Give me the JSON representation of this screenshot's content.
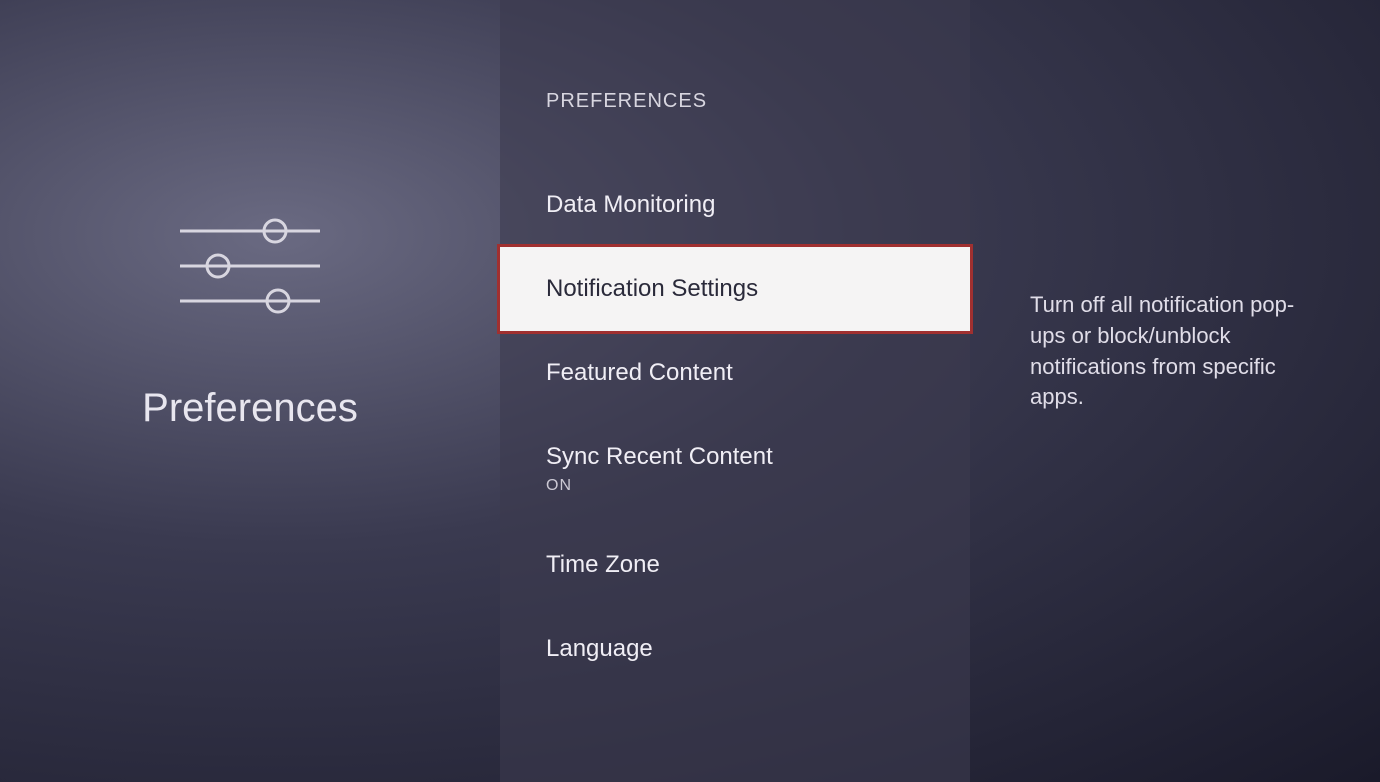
{
  "left": {
    "title": "Preferences"
  },
  "center": {
    "header": "PREFERENCES",
    "items": [
      {
        "label": "Data Monitoring",
        "sub": ""
      },
      {
        "label": "Notification Settings",
        "sub": ""
      },
      {
        "label": "Featured Content",
        "sub": ""
      },
      {
        "label": "Sync Recent Content",
        "sub": "ON"
      },
      {
        "label": "Time Zone",
        "sub": ""
      },
      {
        "label": "Language",
        "sub": ""
      }
    ]
  },
  "right": {
    "description": "Turn off all notification pop-ups or block/unblock notifications from specific apps."
  }
}
